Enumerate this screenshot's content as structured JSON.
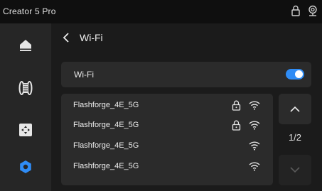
{
  "app": {
    "title": "Creator 5 Pro"
  },
  "sidebar": {
    "items": [
      {
        "icon": "home-icon",
        "active": false
      },
      {
        "icon": "filament-icon",
        "active": false
      },
      {
        "icon": "move-control-icon",
        "active": false
      },
      {
        "icon": "settings-icon",
        "active": true
      }
    ]
  },
  "page": {
    "title": "Wi-Fi"
  },
  "wifi": {
    "label": "Wi-Fi",
    "enabled": true
  },
  "networks": [
    {
      "name": "Flashforge_4E_5G",
      "secured": true
    },
    {
      "name": "Flashforge_4E_5G",
      "secured": true
    },
    {
      "name": "Flashforge_4E_5G",
      "secured": false
    },
    {
      "name": "Flashforge_4E_5G",
      "secured": false
    }
  ],
  "pagination": {
    "indicator": "1/2"
  },
  "colors": {
    "accent": "#2f8cf5",
    "background": "#1b1b1b",
    "panel": "#2b2b2b",
    "sidebar": "#262626",
    "topbar": "#0f0f0f"
  }
}
